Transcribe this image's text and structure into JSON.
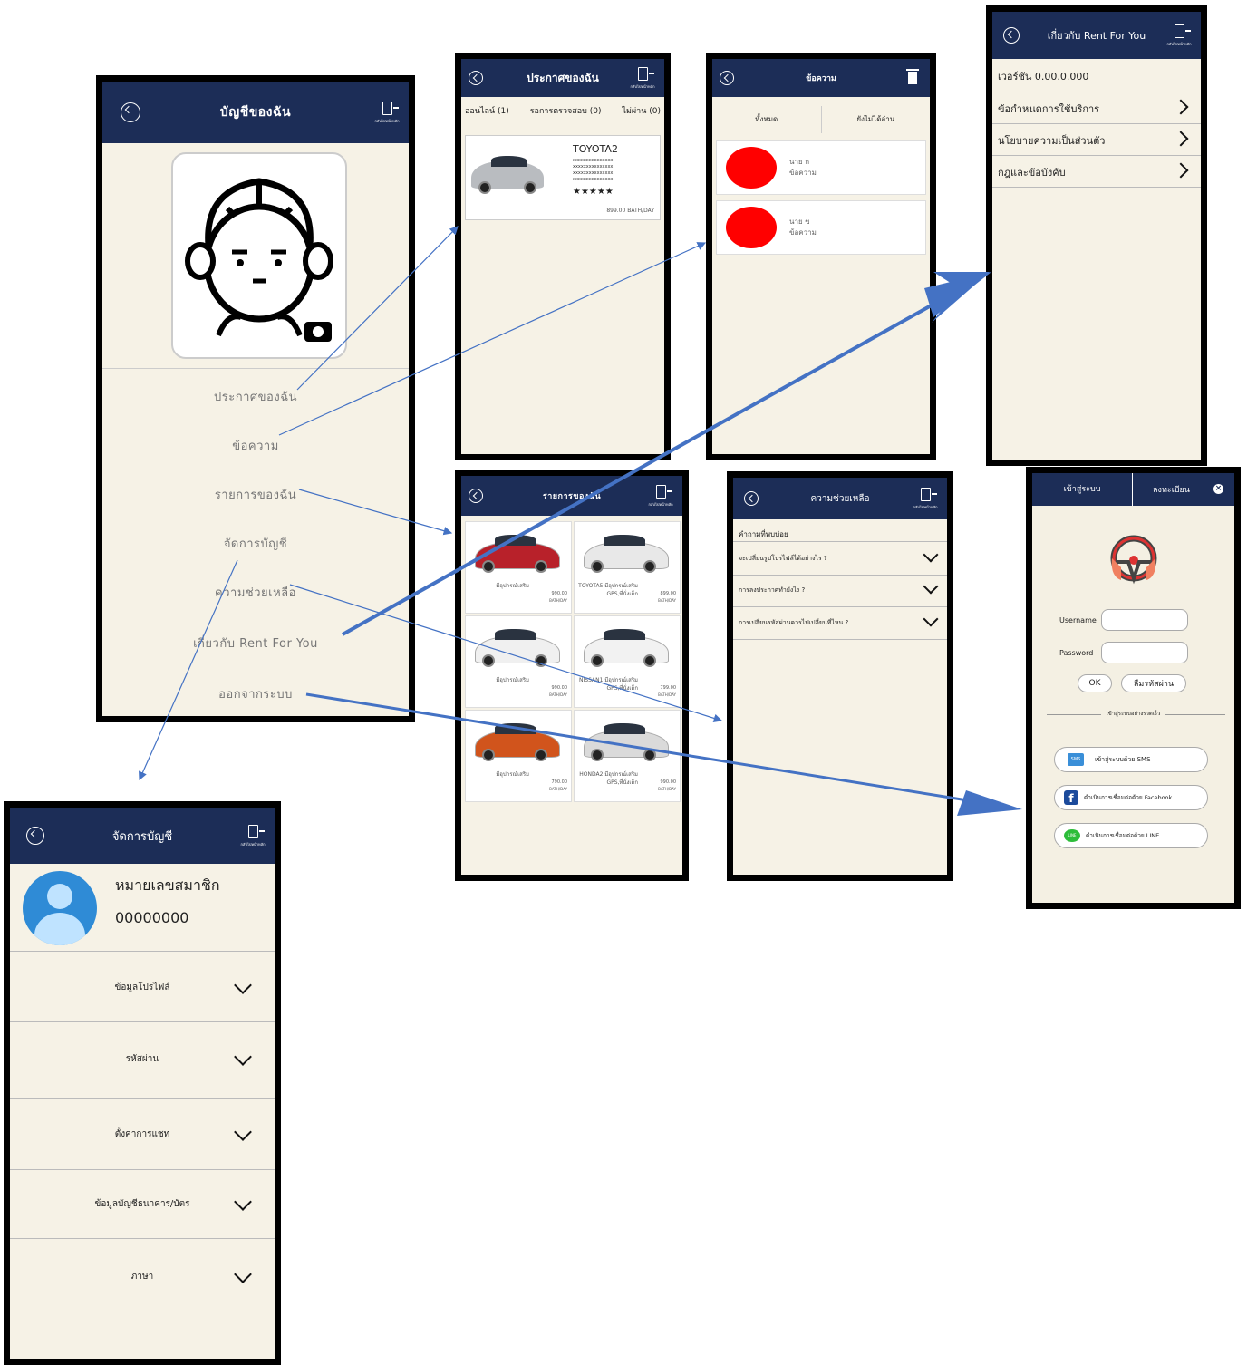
{
  "account": {
    "title": "บัญชีของฉัน",
    "menu": [
      "ประกาศของฉัน",
      "ข้อความ",
      "รายการของฉัน",
      "จัดการบัญชี",
      "ความช่วยเหลือ",
      "เกี่ยวกับ Rent For You",
      "ออกจากระบบ"
    ]
  },
  "announcements": {
    "title": "ประกาศของฉัน",
    "tabs": [
      "ออนไลน์ (1)",
      "รอการตรวจสอบ (0)",
      "ไม่ผ่าน (0)"
    ],
    "card": {
      "name": "TOYOTA2",
      "specs": [
        "xxxxxxxxxxxxxxx",
        "xxxxxxxxxxxxxxx",
        "xxxxxxxxxxxxxxx",
        "xxxxxxxxxxxxxxx"
      ],
      "stars": "★★★★★",
      "price": "899.00 BATH/DAY"
    }
  },
  "messages": {
    "title": "ข้อความ",
    "tabs": [
      "ทั้งหมด",
      "ยังไม่ได้อ่าน"
    ],
    "items": [
      {
        "name": "นาย ก",
        "text": "ข้อความ"
      },
      {
        "name": "นาย ข",
        "text": "ข้อความ"
      }
    ]
  },
  "about": {
    "title": "เกี่ยวกับ Rent For You",
    "version": "เวอร์ชัน 0.00.0.000",
    "items": [
      "ข้อกำหนดการใช้บริการ",
      "นโยบายความเป็นส่วนตัว",
      "กฎและข้อบังคับ"
    ]
  },
  "listings": {
    "title": "รายการของฉัน",
    "cars": [
      {
        "label": "มีอุปกรณ์เสริม",
        "price": "990.00",
        "unit": "BATH/DAY",
        "color": "#b8212a"
      },
      {
        "label": "TOYOTA5 มีอุปกรณ์เสริม GPS,ที่นั่งเด็ก",
        "price": "899.00",
        "unit": "BATH/DAY",
        "color": "#e8e8e8"
      },
      {
        "label": "มีอุปกรณ์เสริม",
        "price": "990.00",
        "unit": "BATH/DAY",
        "color": "#f0f0f0"
      },
      {
        "label": "NISSAN1 มีอุปกรณ์เสริม GPS,ที่นั่งเด็ก",
        "price": "799.00",
        "unit": "BATH/DAY",
        "color": "#f2f2f2"
      },
      {
        "label": "มีอุปกรณ์เสริม",
        "price": "790.00",
        "unit": "BATH/DAY",
        "color": "#d1541c"
      },
      {
        "label": "HONDA2 มีอุปกรณ์เสริม GPS,ที่นั่งเด็ก",
        "price": "990.00",
        "unit": "BATH/DAY",
        "color": "#dadada"
      }
    ]
  },
  "help": {
    "title": "ความช่วยเหลือ",
    "section": "คำถามที่พบบ่อย",
    "faqs": [
      "จะเปลี่ยนรูปโปรไฟล์ได้อย่างไร ?",
      "การลงประกาศทำยังไง ?",
      "การเปลี่ยนรหัสผ่านควรไปเปลี่ยนที่ไหน ?"
    ]
  },
  "login": {
    "tabs": [
      "เข้าสู่ระบบ",
      "ลงทะเบียน"
    ],
    "username_label": "Username",
    "password_label": "Password",
    "ok": "OK",
    "forgot": "ลืมรหัสผ่าน",
    "divider": "เข้าสู่ระบบอย่างรวดเร็ว",
    "sms": "เข้าสู่ระบบด้วย SMS",
    "sms_badge": "SMS",
    "facebook": "ดำเนินการเชื่อมต่อด้วย Facebook",
    "line": "ดำเนินการเชื่อมต่อด้วย LINE",
    "line_badge": "LINE"
  },
  "manage": {
    "title": "จัดการบัญชี",
    "member_label": "หมายเลขสมาชิก",
    "member_no": "00000000",
    "items": [
      "ข้อมูลโปรไฟล์",
      "รหัสผ่าน",
      "ตั้งค่าการแชท",
      "ข้อมูลบัญชีธนาคาร/บัตร",
      "ภาษา"
    ]
  },
  "exit_caption": "กลับไปหน้าหลัก",
  "colors": {
    "header": "#1c2d57",
    "background": "#f6f2e6",
    "arrow": "#4472c4"
  }
}
